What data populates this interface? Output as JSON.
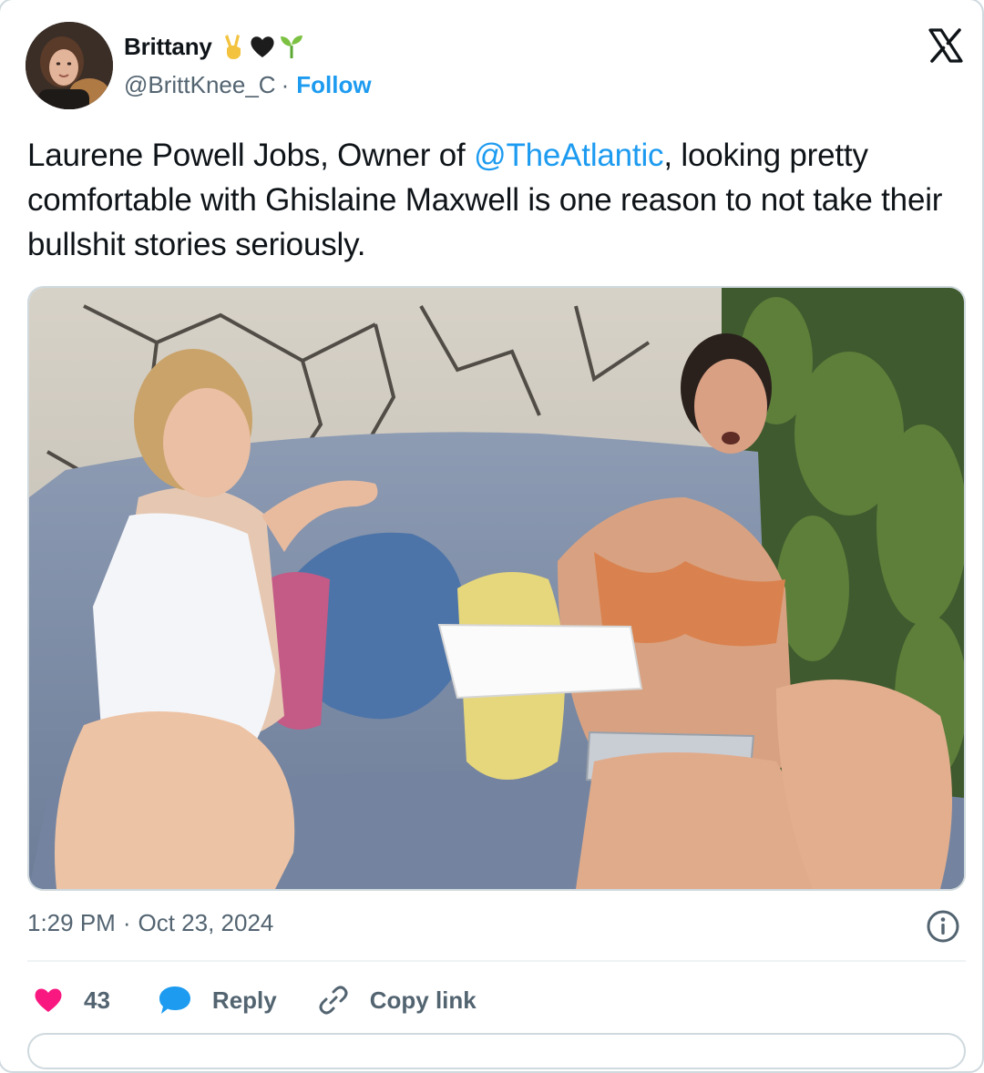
{
  "author": {
    "display_name": "Brittany",
    "name_emojis": [
      "victory-hand-emoji",
      "black-heart-emoji",
      "seedling-emoji"
    ],
    "handle": "@BrittKnee_C",
    "separator": "·",
    "follow_label": "Follow"
  },
  "tweet": {
    "text_before_mention": "Laurene Powell Jobs, Owner of ",
    "mention": "@TheAtlantic",
    "text_after_mention": ", looking pretty comfortable with Ghislaine Maxwell is one reason to not take their bullshit stories seriously."
  },
  "meta": {
    "time": "1:29 PM",
    "separator": "·",
    "date": "Oct 23, 2024"
  },
  "actions": {
    "like_count": "43",
    "reply_label": "Reply",
    "copy_link_label": "Copy link"
  },
  "colors": {
    "accent": "#1d9bf0",
    "like": "#f91880",
    "muted_text": "#536471",
    "border": "#cfd9de"
  },
  "icons": {
    "platform": "x-logo-icon",
    "info": "info-icon",
    "like": "heart-icon",
    "reply": "speech-bubble-icon",
    "copy_link": "link-icon"
  }
}
